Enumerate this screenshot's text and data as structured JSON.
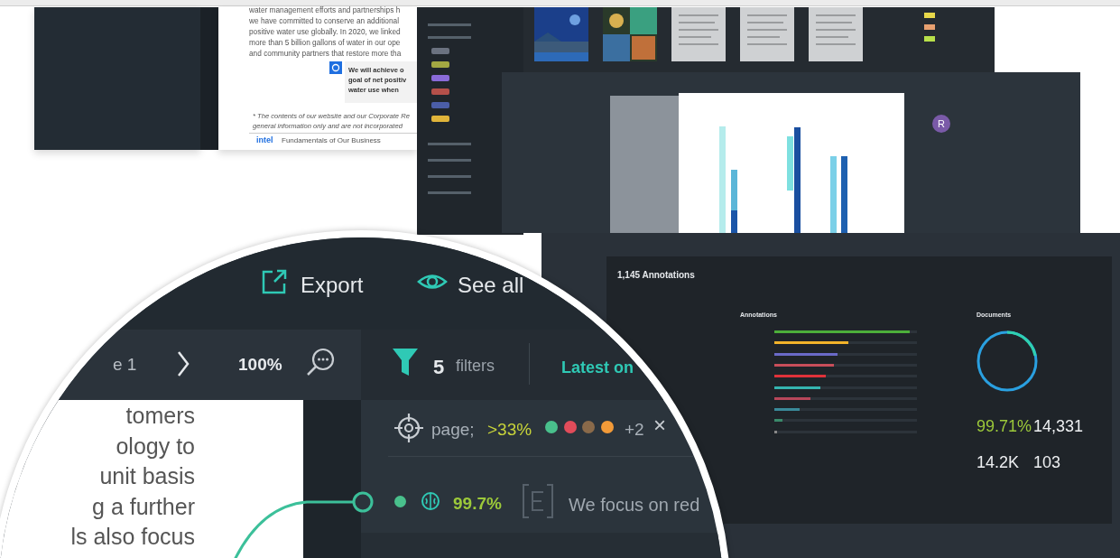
{
  "report_document": {
    "paragraph": [
      "water management efforts and partnerships h",
      "we have committed to conserve an additional",
      "positive water use globally. In 2020, we linked",
      "more than 5 billion gallons of water in our ope",
      "and community partners that restore more tha"
    ],
    "callout": [
      "We will achieve o",
      "goal of net positiv",
      "water use when"
    ],
    "footnote": [
      "* The contents of our website and our Corporate Re",
      "general information only and are not incorporated"
    ],
    "footer_logo": "intel",
    "footer_title": "Fundamentals of Our Business"
  },
  "tag_sidebar": {
    "tags": [
      {
        "color": "#6b7280"
      },
      {
        "color": "#a3a842"
      },
      {
        "color": "#8a6bd9"
      },
      {
        "color": "#b4504a"
      },
      {
        "color": "#4b5ea8"
      },
      {
        "color": "#e0b43a"
      }
    ]
  },
  "thumbnail_strip": {
    "thumbnails": [
      {
        "kind": "picture"
      },
      {
        "kind": "picture"
      },
      {
        "kind": "document"
      },
      {
        "kind": "document"
      },
      {
        "kind": "document"
      }
    ],
    "labels": [
      {
        "color": "#e8d84a"
      },
      {
        "color": "#e8a070"
      },
      {
        "color": "#b8e04a"
      }
    ]
  },
  "annotation_viewer": {
    "avatar": "R"
  },
  "dashboard": {
    "title": "1,145 Annotations",
    "annotations_heading": "Annotations",
    "documents_heading": "Documents",
    "bars": [
      {
        "color": "#4caf3a",
        "level": 0.95
      },
      {
        "color": "#f2b32a",
        "level": 0.52
      },
      {
        "color": "#6a6ac8",
        "level": 0.44
      },
      {
        "color": "#c84e5a",
        "level": 0.42
      },
      {
        "color": "#e0323a",
        "level": 0.36
      },
      {
        "color": "#35b5b0",
        "level": 0.32
      },
      {
        "color": "#b8475a",
        "level": 0.25
      },
      {
        "color": "#3a8a9a",
        "level": 0.18
      },
      {
        "color": "#3a8a6a",
        "level": 0.06
      },
      {
        "color": "#888888",
        "level": 0.02
      }
    ],
    "stats": [
      {
        "value": "99.71%",
        "kind": "highlight"
      },
      {
        "value": "14,331",
        "kind": "plain"
      },
      {
        "value": "14.2K",
        "kind": "plain"
      },
      {
        "value": "103",
        "kind": "plain"
      }
    ]
  },
  "magnifier": {
    "toolbar": [
      {
        "label": "Export"
      },
      {
        "label": "See all"
      }
    ],
    "page_label": "e 1",
    "zoom": "100%",
    "filter_count": "5",
    "filter_label": "filters",
    "sort": "Latest on",
    "document_lines": [
      "tomers",
      "ology to",
      "unit basis",
      "g a further",
      "ls also focus"
    ],
    "filter_chip": {
      "label": "page;",
      "threshold": ">33%",
      "dots": [
        {
          "color": "#49c08c"
        },
        {
          "color": "#e24c5a"
        },
        {
          "color": "#8a6a4a"
        },
        {
          "color": "#f29a38"
        }
      ],
      "more": "+2",
      "clear": "×"
    },
    "annotation": {
      "confidence": "99.7%",
      "text": "We focus on red"
    }
  }
}
